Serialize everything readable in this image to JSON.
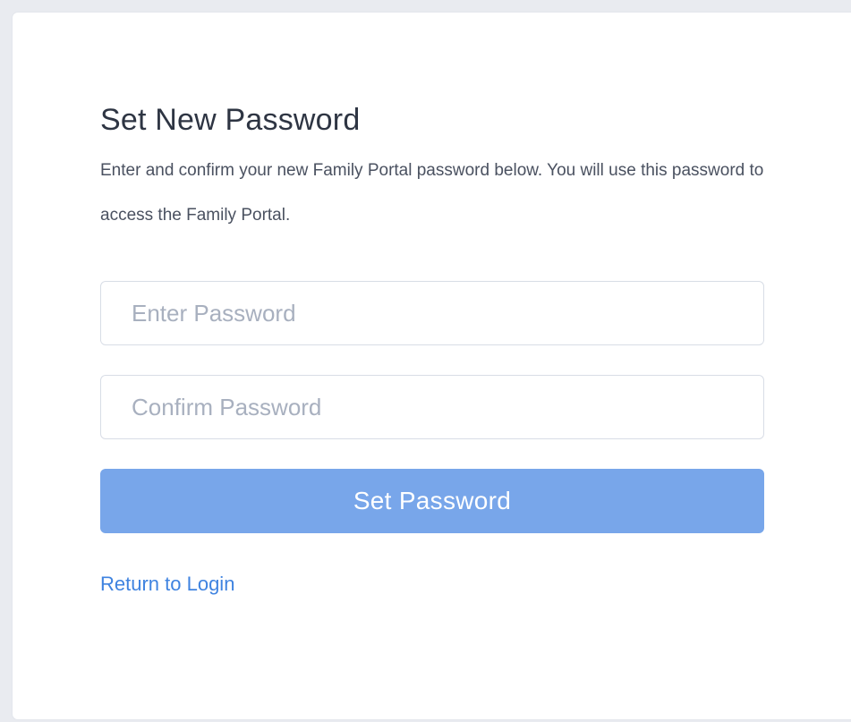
{
  "form": {
    "title": "Set New Password",
    "description": "Enter and confirm your new Family Portal password below. You will use this password to access the Family Portal.",
    "password_placeholder": "Enter Password",
    "confirm_placeholder": "Confirm Password",
    "submit_label": "Set Password",
    "return_link": "Return to Login"
  },
  "colors": {
    "accent_button": "#78a6ea",
    "link": "#3f83e0",
    "title_text": "#2e3543"
  }
}
